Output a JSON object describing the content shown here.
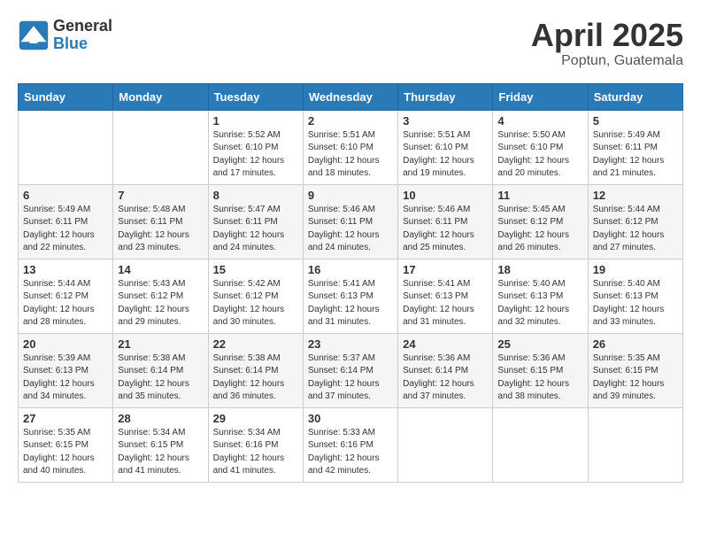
{
  "header": {
    "logo_general": "General",
    "logo_blue": "Blue",
    "title": "April 2025",
    "location": "Poptun, Guatemala"
  },
  "weekdays": [
    "Sunday",
    "Monday",
    "Tuesday",
    "Wednesday",
    "Thursday",
    "Friday",
    "Saturday"
  ],
  "weeks": [
    [
      {
        "num": "",
        "info": ""
      },
      {
        "num": "",
        "info": ""
      },
      {
        "num": "1",
        "info": "Sunrise: 5:52 AM\nSunset: 6:10 PM\nDaylight: 12 hours and 17 minutes."
      },
      {
        "num": "2",
        "info": "Sunrise: 5:51 AM\nSunset: 6:10 PM\nDaylight: 12 hours and 18 minutes."
      },
      {
        "num": "3",
        "info": "Sunrise: 5:51 AM\nSunset: 6:10 PM\nDaylight: 12 hours and 19 minutes."
      },
      {
        "num": "4",
        "info": "Sunrise: 5:50 AM\nSunset: 6:10 PM\nDaylight: 12 hours and 20 minutes."
      },
      {
        "num": "5",
        "info": "Sunrise: 5:49 AM\nSunset: 6:11 PM\nDaylight: 12 hours and 21 minutes."
      }
    ],
    [
      {
        "num": "6",
        "info": "Sunrise: 5:49 AM\nSunset: 6:11 PM\nDaylight: 12 hours and 22 minutes."
      },
      {
        "num": "7",
        "info": "Sunrise: 5:48 AM\nSunset: 6:11 PM\nDaylight: 12 hours and 23 minutes."
      },
      {
        "num": "8",
        "info": "Sunrise: 5:47 AM\nSunset: 6:11 PM\nDaylight: 12 hours and 24 minutes."
      },
      {
        "num": "9",
        "info": "Sunrise: 5:46 AM\nSunset: 6:11 PM\nDaylight: 12 hours and 24 minutes."
      },
      {
        "num": "10",
        "info": "Sunrise: 5:46 AM\nSunset: 6:11 PM\nDaylight: 12 hours and 25 minutes."
      },
      {
        "num": "11",
        "info": "Sunrise: 5:45 AM\nSunset: 6:12 PM\nDaylight: 12 hours and 26 minutes."
      },
      {
        "num": "12",
        "info": "Sunrise: 5:44 AM\nSunset: 6:12 PM\nDaylight: 12 hours and 27 minutes."
      }
    ],
    [
      {
        "num": "13",
        "info": "Sunrise: 5:44 AM\nSunset: 6:12 PM\nDaylight: 12 hours and 28 minutes."
      },
      {
        "num": "14",
        "info": "Sunrise: 5:43 AM\nSunset: 6:12 PM\nDaylight: 12 hours and 29 minutes."
      },
      {
        "num": "15",
        "info": "Sunrise: 5:42 AM\nSunset: 6:12 PM\nDaylight: 12 hours and 30 minutes."
      },
      {
        "num": "16",
        "info": "Sunrise: 5:41 AM\nSunset: 6:13 PM\nDaylight: 12 hours and 31 minutes."
      },
      {
        "num": "17",
        "info": "Sunrise: 5:41 AM\nSunset: 6:13 PM\nDaylight: 12 hours and 31 minutes."
      },
      {
        "num": "18",
        "info": "Sunrise: 5:40 AM\nSunset: 6:13 PM\nDaylight: 12 hours and 32 minutes."
      },
      {
        "num": "19",
        "info": "Sunrise: 5:40 AM\nSunset: 6:13 PM\nDaylight: 12 hours and 33 minutes."
      }
    ],
    [
      {
        "num": "20",
        "info": "Sunrise: 5:39 AM\nSunset: 6:13 PM\nDaylight: 12 hours and 34 minutes."
      },
      {
        "num": "21",
        "info": "Sunrise: 5:38 AM\nSunset: 6:14 PM\nDaylight: 12 hours and 35 minutes."
      },
      {
        "num": "22",
        "info": "Sunrise: 5:38 AM\nSunset: 6:14 PM\nDaylight: 12 hours and 36 minutes."
      },
      {
        "num": "23",
        "info": "Sunrise: 5:37 AM\nSunset: 6:14 PM\nDaylight: 12 hours and 37 minutes."
      },
      {
        "num": "24",
        "info": "Sunrise: 5:36 AM\nSunset: 6:14 PM\nDaylight: 12 hours and 37 minutes."
      },
      {
        "num": "25",
        "info": "Sunrise: 5:36 AM\nSunset: 6:15 PM\nDaylight: 12 hours and 38 minutes."
      },
      {
        "num": "26",
        "info": "Sunrise: 5:35 AM\nSunset: 6:15 PM\nDaylight: 12 hours and 39 minutes."
      }
    ],
    [
      {
        "num": "27",
        "info": "Sunrise: 5:35 AM\nSunset: 6:15 PM\nDaylight: 12 hours and 40 minutes."
      },
      {
        "num": "28",
        "info": "Sunrise: 5:34 AM\nSunset: 6:15 PM\nDaylight: 12 hours and 41 minutes."
      },
      {
        "num": "29",
        "info": "Sunrise: 5:34 AM\nSunset: 6:16 PM\nDaylight: 12 hours and 41 minutes."
      },
      {
        "num": "30",
        "info": "Sunrise: 5:33 AM\nSunset: 6:16 PM\nDaylight: 12 hours and 42 minutes."
      },
      {
        "num": "",
        "info": ""
      },
      {
        "num": "",
        "info": ""
      },
      {
        "num": "",
        "info": ""
      }
    ]
  ]
}
